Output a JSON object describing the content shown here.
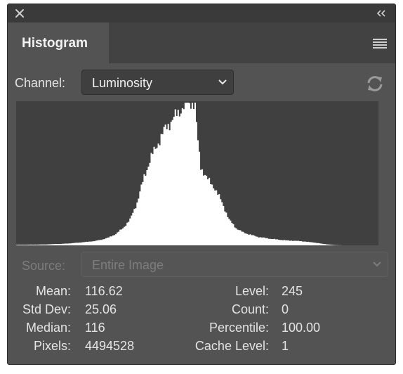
{
  "window": {
    "close_icon": "close-icon",
    "collapse_icon": "double-chevron-left-icon"
  },
  "tab": {
    "label": "Histogram",
    "menu_icon": "hamburger-menu-icon"
  },
  "channel": {
    "label": "Channel:",
    "value": "Luminosity",
    "refresh_icon": "refresh-icon"
  },
  "source": {
    "label": "Source:",
    "value": "Entire Image",
    "enabled": false
  },
  "stats": {
    "mean_label": "Mean:",
    "mean_value": "116.62",
    "stddev_label": "Std Dev:",
    "stddev_value": "25.06",
    "median_label": "Median:",
    "median_value": "116",
    "pixels_label": "Pixels:",
    "pixels_value": "4494528",
    "level_label": "Level:",
    "level_value": "245",
    "count_label": "Count:",
    "count_value": "0",
    "percentile_label": "Percentile:",
    "percentile_value": "100.00",
    "cachelevel_label": "Cache Level:",
    "cachelevel_value": "1"
  },
  "colors": {
    "panel_bg": "#535353",
    "histogram_bg": "#404040",
    "histogram_fill": "#ffffff",
    "text": "#e4e4e4",
    "disabled_text": "#7d7d7d"
  },
  "histogram": {
    "levels": 256,
    "max_relative": 1.0,
    "control_points": [
      [
        0,
        0.004
      ],
      [
        20,
        0.006
      ],
      [
        35,
        0.012
      ],
      [
        45,
        0.02
      ],
      [
        55,
        0.03
      ],
      [
        60,
        0.04
      ],
      [
        65,
        0.055
      ],
      [
        70,
        0.08
      ],
      [
        75,
        0.12
      ],
      [
        80,
        0.18
      ],
      [
        85,
        0.3
      ],
      [
        90,
        0.48
      ],
      [
        95,
        0.62
      ],
      [
        100,
        0.72
      ],
      [
        105,
        0.82
      ],
      [
        110,
        0.88
      ],
      [
        115,
        0.94
      ],
      [
        120,
        1.0
      ],
      [
        125,
        1.0
      ],
      [
        126,
        0.98
      ],
      [
        128,
        0.72
      ],
      [
        130,
        0.55
      ],
      [
        135,
        0.46
      ],
      [
        140,
        0.4
      ],
      [
        145,
        0.3
      ],
      [
        150,
        0.18
      ],
      [
        155,
        0.12
      ],
      [
        160,
        0.09
      ],
      [
        170,
        0.06
      ],
      [
        180,
        0.045
      ],
      [
        190,
        0.035
      ],
      [
        200,
        0.03
      ],
      [
        210,
        0.02
      ],
      [
        215,
        0.012
      ],
      [
        220,
        0.006
      ],
      [
        225,
        0.002
      ],
      [
        230,
        0.0
      ],
      [
        255,
        0.0
      ]
    ]
  }
}
